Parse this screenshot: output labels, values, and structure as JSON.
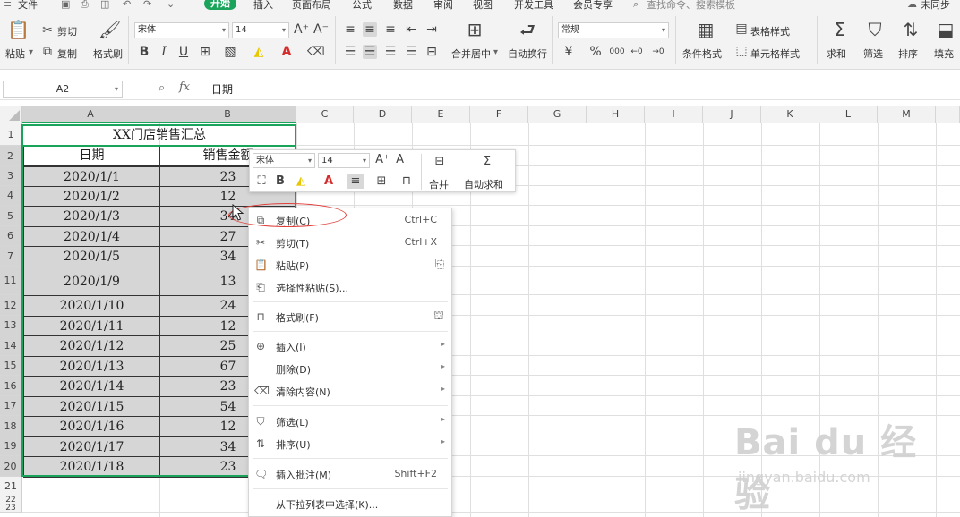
{
  "menubar": {
    "file": "文件",
    "tabs": [
      "开始",
      "插入",
      "页面布局",
      "公式",
      "数据",
      "审阅",
      "视图",
      "开发工具",
      "会员专享"
    ],
    "search": "查找命令、搜索模板",
    "sync": "未同步"
  },
  "ribbon": {
    "paste": "粘贴",
    "cut": "剪切",
    "copy": "复制",
    "format_painter": "格式刷",
    "font": "宋体",
    "font_size": "14",
    "bold": "B",
    "italic": "I",
    "underline": "U",
    "merge_center": "合并居中",
    "wrap_text": "自动换行",
    "number_format": "常规",
    "percent": "%",
    "thousands": "000",
    "conditional_format": "条件格式",
    "table_style": "表格样式",
    "cell_style": "单元格样式",
    "sum": "求和",
    "filter": "筛选",
    "sort": "排序",
    "fill": "填充"
  },
  "formula_bar": {
    "name_box": "A2",
    "fx": "fx",
    "value": "日期"
  },
  "sheet": {
    "columns": [
      "A",
      "B",
      "C",
      "D",
      "E",
      "F",
      "G",
      "H",
      "I",
      "J",
      "K",
      "L",
      "M"
    ],
    "row_numbers": [
      "1",
      "2",
      "3",
      "4",
      "5",
      "6",
      "7",
      "11",
      "12",
      "13",
      "14",
      "15",
      "16",
      "17",
      "18",
      "19",
      "20",
      "21",
      "22",
      "23"
    ],
    "title": "XX门店销售汇总",
    "header_date": "日期",
    "header_amount": "销售金额",
    "rows": [
      {
        "date": "2020/1/1",
        "amount": "23"
      },
      {
        "date": "2020/1/2",
        "amount": "12"
      },
      {
        "date": "2020/1/3",
        "amount": "34"
      },
      {
        "date": "2020/1/4",
        "amount": "27"
      },
      {
        "date": "2020/1/5",
        "amount": "34"
      },
      {
        "date": "2020/1/9",
        "amount": "13"
      },
      {
        "date": "2020/1/10",
        "amount": "24"
      },
      {
        "date": "2020/1/11",
        "amount": "12"
      },
      {
        "date": "2020/1/12",
        "amount": "25"
      },
      {
        "date": "2020/1/13",
        "amount": "67"
      },
      {
        "date": "2020/1/14",
        "amount": "23"
      },
      {
        "date": "2020/1/15",
        "amount": "54"
      },
      {
        "date": "2020/1/16",
        "amount": "12"
      },
      {
        "date": "2020/1/17",
        "amount": "34"
      },
      {
        "date": "2020/1/18",
        "amount": "23"
      }
    ]
  },
  "mini_toolbar": {
    "font": "宋体",
    "font_size": "14",
    "bold": "B",
    "merge": "合并",
    "autosum": "自动求和"
  },
  "context_menu": {
    "copy": "复制(C)",
    "copy_shortcut": "Ctrl+C",
    "cut": "剪切(T)",
    "cut_shortcut": "Ctrl+X",
    "paste": "粘贴(P)",
    "paste_special": "选择性粘贴(S)...",
    "format_painter": "格式刷(F)",
    "insert": "插入(I)",
    "delete": "删除(D)",
    "clear": "清除内容(N)",
    "filter": "筛选(L)",
    "sort": "排序(U)",
    "comment": "插入批注(M)",
    "comment_shortcut": "Shift+F2",
    "pick_list": "从下拉列表中选择(K)..."
  },
  "watermark": {
    "logo": "Bai du 经验",
    "url": "jingyan.baidu.com"
  },
  "colors": {
    "accent": "#1aa35a",
    "highlight": "#e0403c",
    "selection_fill": "#d6d6d6"
  }
}
